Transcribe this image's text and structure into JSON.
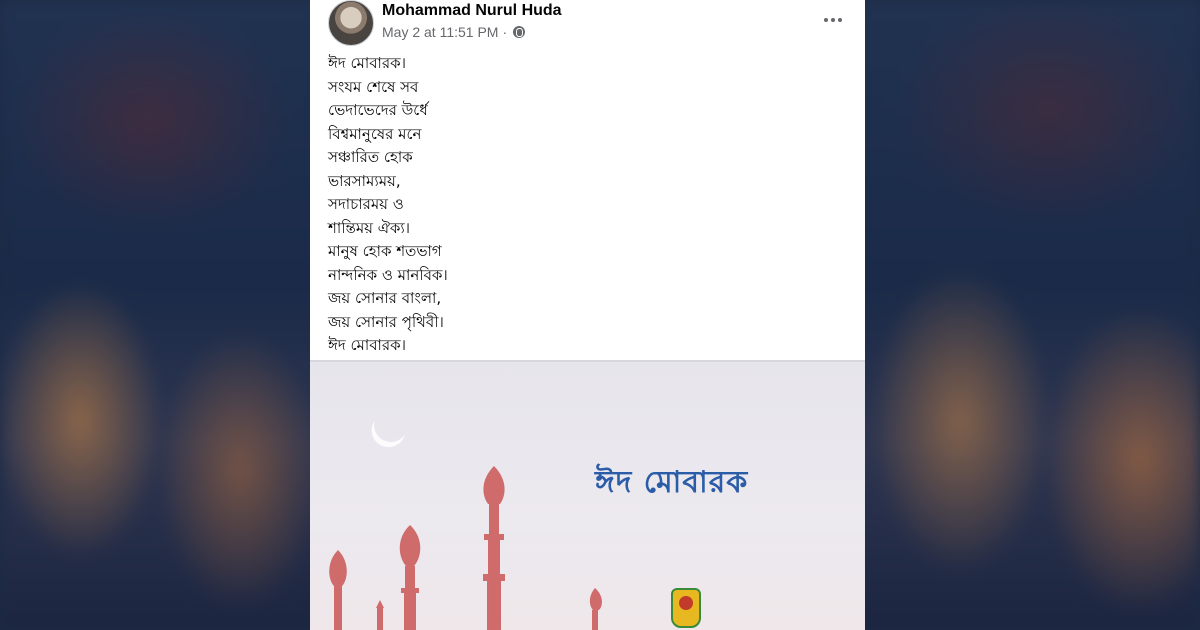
{
  "post": {
    "author": "Mohammad Nurul Huda",
    "timestamp": "May 2 at 11:51 PM",
    "separator": "·",
    "audience_icon": "globe-icon",
    "menu_icon": "more-options-icon",
    "lines": [
      "ঈদ মোবারক।",
      "সংযম শেষে সব",
      "ভেদাভেদের উর্ধে",
      "বিশ্বমানুষের মনে",
      "সঞ্চারিত হোক",
      "ভারসাম্যময়,",
      "সদাচারময় ও",
      "শান্তিময় ঐক্য।",
      "মানুষ হোক শতভাগ",
      "নান্দনিক ও মানবিক।",
      "জয় সোনার বাংলা,",
      "জয় সোনার পৃথিবী।",
      "ঈদ মোবারক।"
    ]
  },
  "image": {
    "caption": "ঈদ মোবারক",
    "caption_color": "#2a5ca8",
    "minaret_color": "#cf6b6b"
  },
  "colors": {
    "card_bg": "#ffffff",
    "author_text": "#050505",
    "meta_text": "#65676b"
  }
}
